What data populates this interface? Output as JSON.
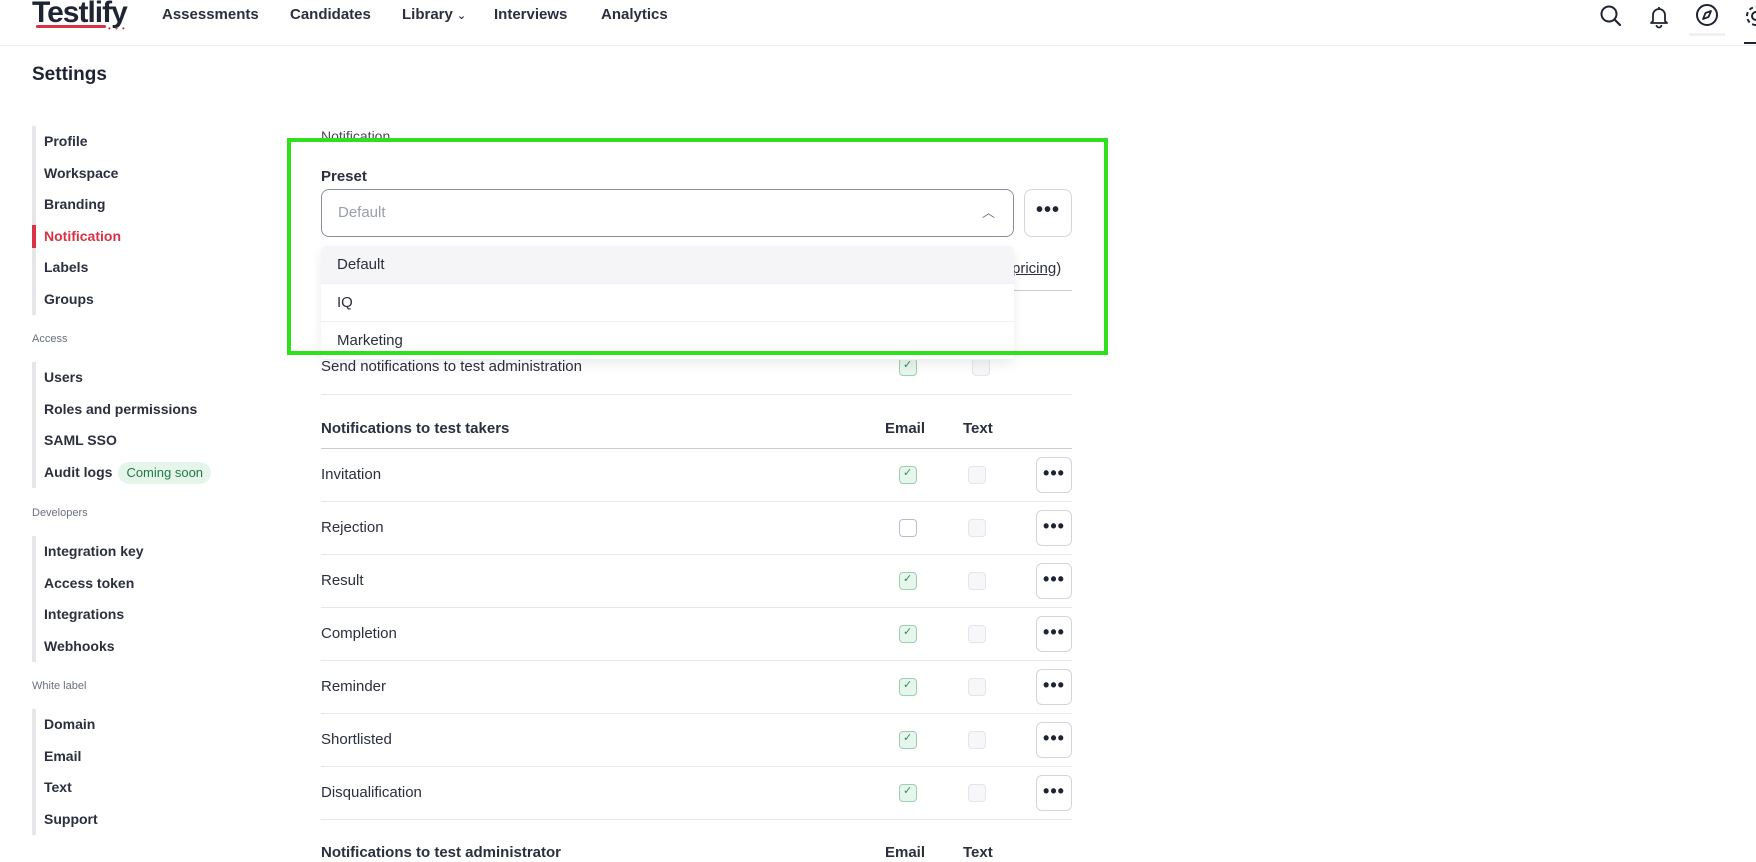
{
  "nav": {
    "logo": "Testlify",
    "links": [
      "Assessments",
      "Candidates",
      "Library",
      "Interviews",
      "Analytics"
    ]
  },
  "page_title": "Settings",
  "sidebar": {
    "group1": [
      "Profile",
      "Workspace",
      "Branding",
      "Notification",
      "Labels",
      "Groups"
    ],
    "access_heading": "Access",
    "access": [
      "Users",
      "Roles and permissions",
      "SAML SSO",
      "Audit logs"
    ],
    "audit_badge": "Coming soon",
    "developers_heading": "Developers",
    "developers": [
      "Integration key",
      "Access token",
      "Integrations",
      "Webhooks"
    ],
    "whitelabel_heading": "White label",
    "whitelabel": [
      "Domain",
      "Email",
      "Text",
      "Support"
    ],
    "active": "Notification",
    "active_color": "#d93244"
  },
  "main": {
    "section_label": "Notification",
    "preset_label": "Preset",
    "preset_placeholder": "Default",
    "dropdown_options": [
      "Default",
      "IQ",
      "Marketing"
    ],
    "pricing_link": "pricing",
    "pricing_close": ")",
    "send_admin_label": "Send notifications to test administration",
    "takers_header": "Notifications to test takers",
    "admin_header": "Notifications to test administrator",
    "col_email": "Email",
    "col_text": "Text",
    "more": "•••",
    "rows": [
      {
        "label": "Invitation",
        "email": true
      },
      {
        "label": "Rejection",
        "email": false
      },
      {
        "label": "Result",
        "email": true
      },
      {
        "label": "Completion",
        "email": true
      },
      {
        "label": "Reminder",
        "email": true
      },
      {
        "label": "Shortlisted",
        "email": true
      },
      {
        "label": "Disqualification",
        "email": true
      }
    ]
  },
  "highlight_color": "#2fe01c"
}
